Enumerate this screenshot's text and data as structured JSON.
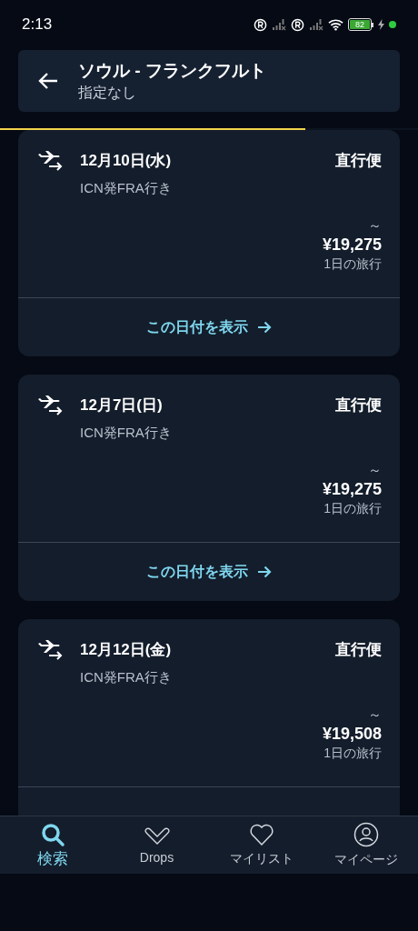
{
  "status_bar": {
    "time": "2:13",
    "battery": "82"
  },
  "header": {
    "title": "ソウル - フランクフルト",
    "subtitle": "指定なし"
  },
  "progress": {
    "level": 0.73
  },
  "results": [
    {
      "date": "12月10日(水)",
      "type": "直行便",
      "route": "ICN発FRA行き",
      "prefix": "～",
      "price": "¥19,275",
      "duration": "1日の旅行",
      "link": "この日付を表示"
    },
    {
      "date": "12月7日(日)",
      "type": "直行便",
      "route": "ICN発FRA行き",
      "prefix": "～",
      "price": "¥19,275",
      "duration": "1日の旅行",
      "link": "この日付を表示"
    },
    {
      "date": "12月12日(金)",
      "type": "直行便",
      "route": "ICN発FRA行き",
      "prefix": "～",
      "price": "¥19,508",
      "duration": "1日の旅行"
    }
  ],
  "nav": [
    {
      "kind": "search",
      "label": "検索",
      "selected": true
    },
    {
      "kind": "drops",
      "label": "Drops",
      "selected": false
    },
    {
      "kind": "heart",
      "label": "マイリスト",
      "selected": false
    },
    {
      "kind": "profile",
      "label": "マイページ",
      "selected": false
    }
  ]
}
